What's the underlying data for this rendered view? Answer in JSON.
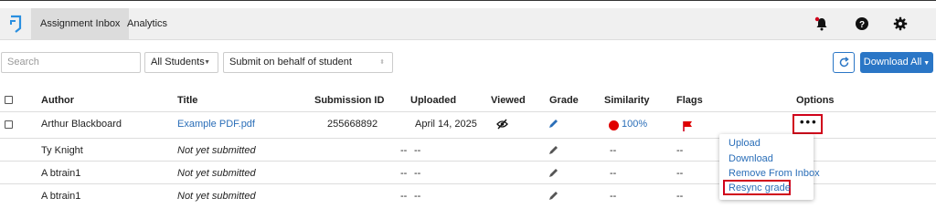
{
  "nav": {
    "tabs": [
      {
        "label": "Assignment Inbox",
        "active": true
      },
      {
        "label": "Analytics",
        "active": false
      }
    ],
    "icons": [
      "notifications-bell-icon",
      "help-icon",
      "settings-gear-icon"
    ]
  },
  "toolbar": {
    "search_placeholder": "Search",
    "students_select": "All Students",
    "behalf_select": "Submit on behalf of student",
    "download_label": "Download All",
    "accent_color": "#2a76c6"
  },
  "table": {
    "headers": [
      "Author",
      "Title",
      "Submission ID",
      "Uploaded",
      "Viewed",
      "Grade",
      "Similarity",
      "Flags",
      "Options"
    ],
    "rows": [
      {
        "author": "Arthur Blackboard",
        "title": "Example PDF.pdf",
        "submission_id": "255668892",
        "uploaded": "April 14, 2025",
        "similarity": "100%"
      },
      {
        "author": "Ty Knight",
        "title": "Not yet submitted",
        "submission_id": "--",
        "uploaded": "--",
        "similarity": "--",
        "flags": "--"
      },
      {
        "author": "A btrain1",
        "title": "Not yet submitted",
        "submission_id": "--",
        "uploaded": "--",
        "similarity": "--",
        "flags": "--"
      },
      {
        "author": "A btrain1",
        "title": "Not yet submitted",
        "submission_id": "--",
        "uploaded": "--",
        "similarity": "--",
        "flags": "--"
      }
    ]
  },
  "options_menu": {
    "items": [
      "Upload",
      "Download",
      "Remove From Inbox",
      "Resync grade"
    ],
    "highlight_color": "#d0021b"
  }
}
